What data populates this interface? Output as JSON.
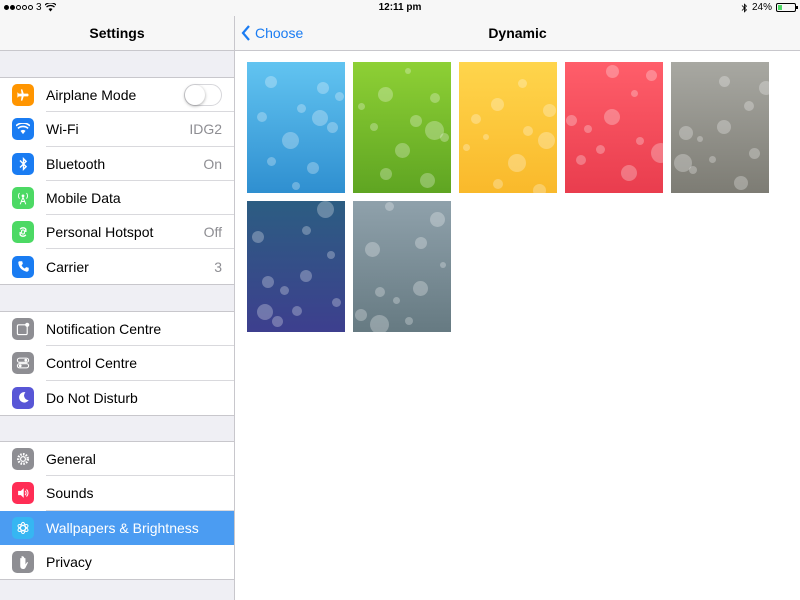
{
  "status_bar": {
    "carrier": "3",
    "time": "12:11 pm",
    "battery": "24%",
    "battery_level": 0.24
  },
  "sidebar": {
    "title": "Settings",
    "groups": [
      [
        {
          "label": "Airplane Mode",
          "icon": "airplane-icon",
          "color": "#ff9500",
          "type": "toggle",
          "on": false
        },
        {
          "label": "Wi-Fi",
          "icon": "wifi-icon",
          "color": "#1a7cf2",
          "value": "IDG2"
        },
        {
          "label": "Bluetooth",
          "icon": "bluetooth-icon",
          "color": "#1a7cf2",
          "value": "On"
        },
        {
          "label": "Mobile Data",
          "icon": "antenna-icon",
          "color": "#4cd964",
          "value": ""
        },
        {
          "label": "Personal Hotspot",
          "icon": "hotspot-icon",
          "color": "#4cd964",
          "value": "Off"
        },
        {
          "label": "Carrier",
          "icon": "phone-icon",
          "color": "#1a7cf2",
          "value": "3"
        }
      ],
      [
        {
          "label": "Notification Centre",
          "icon": "notification-icon",
          "color": "#8e8e93"
        },
        {
          "label": "Control Centre",
          "icon": "control-centre-icon",
          "color": "#8e8e93"
        },
        {
          "label": "Do Not Disturb",
          "icon": "moon-icon",
          "color": "#5856d6"
        }
      ],
      [
        {
          "label": "General",
          "icon": "gear-icon",
          "color": "#8e8e93"
        },
        {
          "label": "Sounds",
          "icon": "speaker-icon",
          "color": "#ff2d55"
        },
        {
          "label": "Wallpapers & Brightness",
          "icon": "flower-icon",
          "color": "#36b6f2",
          "selected": true
        },
        {
          "label": "Privacy",
          "icon": "hand-icon",
          "color": "#8e8e93"
        }
      ]
    ]
  },
  "main": {
    "back_label": "Choose",
    "title": "Dynamic",
    "wallpapers": [
      {
        "name": "blue",
        "top": "#62c4f1",
        "bottom": "#2f8fd0"
      },
      {
        "name": "green",
        "top": "#8ed035",
        "bottom": "#5fa522"
      },
      {
        "name": "yellow",
        "top": "#ffd54c",
        "bottom": "#f9b92b"
      },
      {
        "name": "red",
        "top": "#ff5e6a",
        "bottom": "#e93d4e"
      },
      {
        "name": "grey",
        "top": "#a8a8a2",
        "bottom": "#7d7c74"
      },
      {
        "name": "night-blue",
        "top": "#2c5d82",
        "bottom": "#3d3f8e"
      },
      {
        "name": "slate",
        "top": "#8fa1ab",
        "bottom": "#667a82"
      }
    ]
  }
}
